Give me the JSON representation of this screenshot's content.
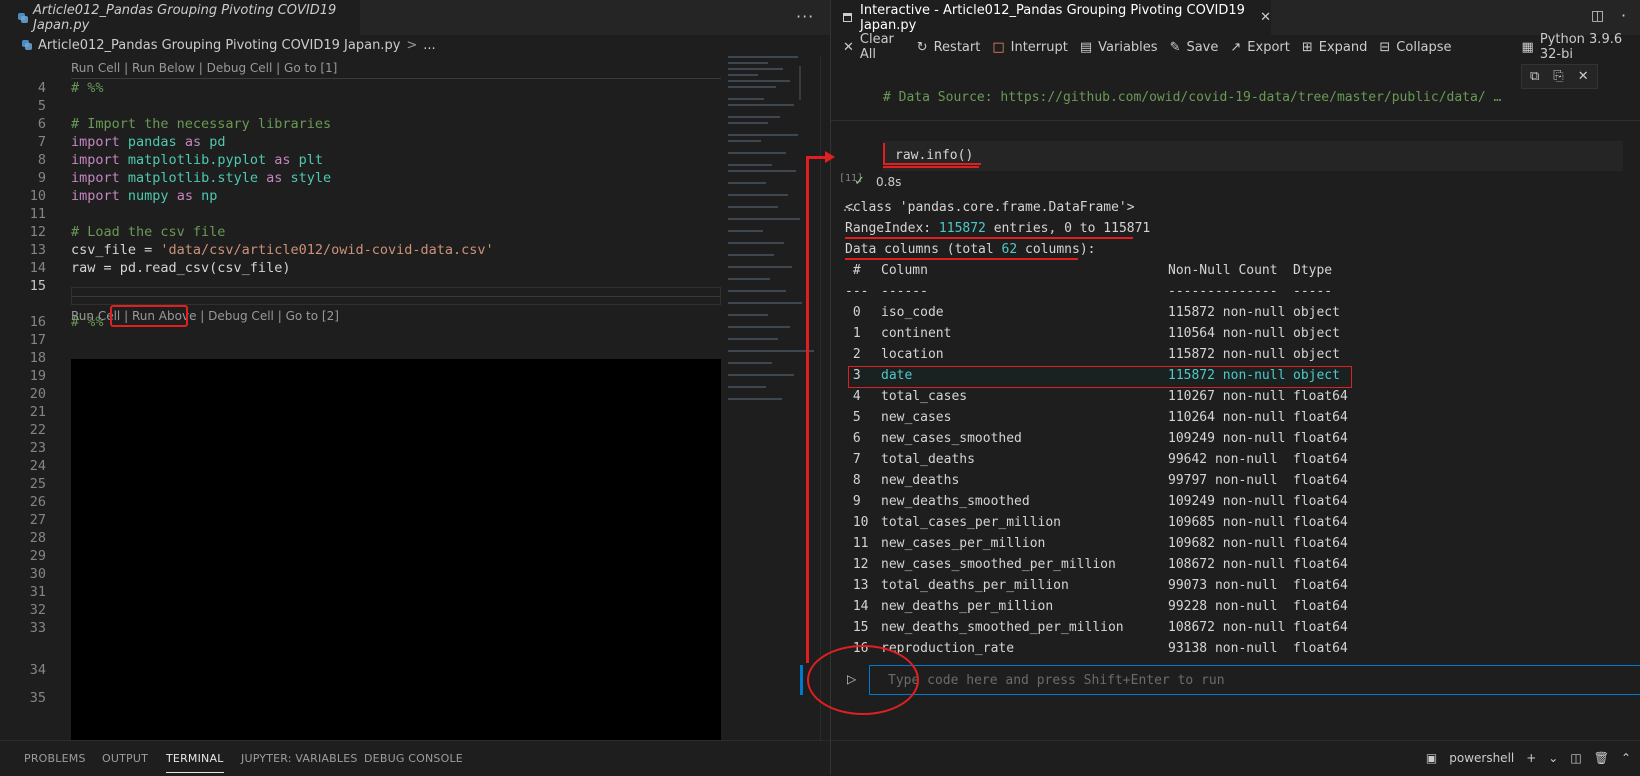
{
  "editor": {
    "tab_title": "Article012_Pandas Grouping Pivoting COVID19 Japan.py",
    "more_icon": "ellipsis-icon",
    "breadcrumb": {
      "file": "Article012_Pandas Grouping Pivoting COVID19 Japan.py",
      "sep": ">",
      "more": "..."
    },
    "codelens1": {
      "run_cell": "Run Cell",
      "run_below": "Run Below",
      "debug_cell": "Debug Cell",
      "goto": "Go to [1]"
    },
    "codelens2": {
      "run_cell": "Run Cell",
      "run_above": "Run Above",
      "debug_cell": "Debug Cell",
      "goto": "Go to [2]"
    },
    "lines": {
      "n4": "4",
      "n5": "5",
      "n6": "6",
      "n7": "7",
      "n8": "8",
      "n9": "9",
      "n10": "10",
      "n11": "11",
      "n12": "12",
      "n13": "13",
      "n14": "14",
      "n15": "15",
      "n16": "16",
      "n17": "17",
      "n18": "18",
      "n19": "19",
      "n20": "20",
      "n21": "21",
      "n22": "22",
      "n23": "23",
      "n24": "24",
      "n25": "25",
      "n26": "26",
      "n27": "27",
      "n28": "28",
      "n29": "29",
      "n30": "30",
      "n31": "31",
      "n32": "32",
      "n33": "33",
      "n34": "34",
      "n35": "35"
    },
    "code": {
      "l4": "# %%",
      "l6": "# Import the necessary libraries",
      "kw_import": "import",
      "kw_as": "as",
      "l7_mod": "pandas",
      "l7_alias": "pd",
      "l8_mod": "matplotlib.pyplot",
      "l8_alias": "plt",
      "l9_mod": "matplotlib.style",
      "l9_alias": "style",
      "l10_mod": "numpy",
      "l10_alias": "np",
      "l12": "# Load the csv file",
      "l13_lhs": "csv_file = ",
      "l13_str": "'data/csv/article012/owid-covid-data.csv'",
      "l14": "raw = pd.read_csv(csv_file)",
      "l16": "# %%"
    }
  },
  "panel_tabs": [
    "PROBLEMS",
    "OUTPUT",
    "TERMINAL",
    "JUPYTER: VARIABLES",
    "DEBUG CONSOLE"
  ],
  "interactive": {
    "tab_title": "Interactive - Article012_Pandas Grouping Pivoting COVID19 Japan.py",
    "tab_close": "✕",
    "toolbar": {
      "clear_all": "Clear All",
      "restart": "Restart",
      "interrupt": "Interrupt",
      "variables": "Variables",
      "save": "Save",
      "export": "Export",
      "expand": "Expand",
      "collapse": "Collapse",
      "kernel": "Python 3.9.6 32-bi"
    },
    "data_source": "# Data Source: https://github.com/owid/covid-19-data/tree/master/public/data/ …",
    "input_code": "raw.info()",
    "exec_count": "[11]",
    "exec_time": "0.8s",
    "output_dots": "...",
    "out_class": "<class 'pandas.core.frame.DataFrame'>",
    "range_prefix": "RangeIndex: ",
    "range_num": "115872",
    "range_suffix": " entries, 0 to 115871",
    "cols_prefix": "Data columns (total ",
    "cols_num": "62",
    "cols_suffix": " columns):",
    "hdr": {
      "idx": " #",
      "col": "Column",
      "cnt": "Non-Null Count",
      "dt": "Dtype"
    },
    "sep": {
      "idx": "---",
      "col": "------",
      "cnt": "--------------",
      "dt": "-----"
    },
    "rows": [
      {
        "idx": " 0",
        "col": "iso_code",
        "cnt": "115872 non-null",
        "dt": "object"
      },
      {
        "idx": " 1",
        "col": "continent",
        "cnt": "110564 non-null",
        "dt": "object"
      },
      {
        "idx": " 2",
        "col": "location",
        "cnt": "115872 non-null",
        "dt": "object"
      },
      {
        "idx": " 3",
        "col": "date",
        "cnt": "115872 non-null",
        "dt": "object"
      },
      {
        "idx": " 4",
        "col": "total_cases",
        "cnt": "110267 non-null",
        "dt": "float64"
      },
      {
        "idx": " 5",
        "col": "new_cases",
        "cnt": "110264 non-null",
        "dt": "float64"
      },
      {
        "idx": " 6",
        "col": "new_cases_smoothed",
        "cnt": "109249 non-null",
        "dt": "float64"
      },
      {
        "idx": " 7",
        "col": "total_deaths",
        "cnt": "99642 non-null",
        "dt": "float64"
      },
      {
        "idx": " 8",
        "col": "new_deaths",
        "cnt": "99797 non-null",
        "dt": "float64"
      },
      {
        "idx": " 9",
        "col": "new_deaths_smoothed",
        "cnt": "109249 non-null",
        "dt": "float64"
      },
      {
        "idx": " 10",
        "col": "total_cases_per_million",
        "cnt": "109685 non-null",
        "dt": "float64"
      },
      {
        "idx": " 11",
        "col": "new_cases_per_million",
        "cnt": "109682 non-null",
        "dt": "float64"
      },
      {
        "idx": " 12",
        "col": "new_cases_smoothed_per_million",
        "cnt": "108672 non-null",
        "dt": "float64"
      },
      {
        "idx": " 13",
        "col": "total_deaths_per_million",
        "cnt": "99073 non-null",
        "dt": "float64"
      },
      {
        "idx": " 14",
        "col": "new_deaths_per_million",
        "cnt": "99228 non-null",
        "dt": "float64"
      },
      {
        "idx": " 15",
        "col": "new_deaths_smoothed_per_million",
        "cnt": "108672 non-null",
        "dt": "float64"
      },
      {
        "idx": " 16",
        "col": "reproduction_rate",
        "cnt": "93138 non-null",
        "dt": "float64"
      }
    ],
    "input_placeholder": "Type code here and press Shift+Enter to run",
    "terminal_name": "powershell"
  }
}
